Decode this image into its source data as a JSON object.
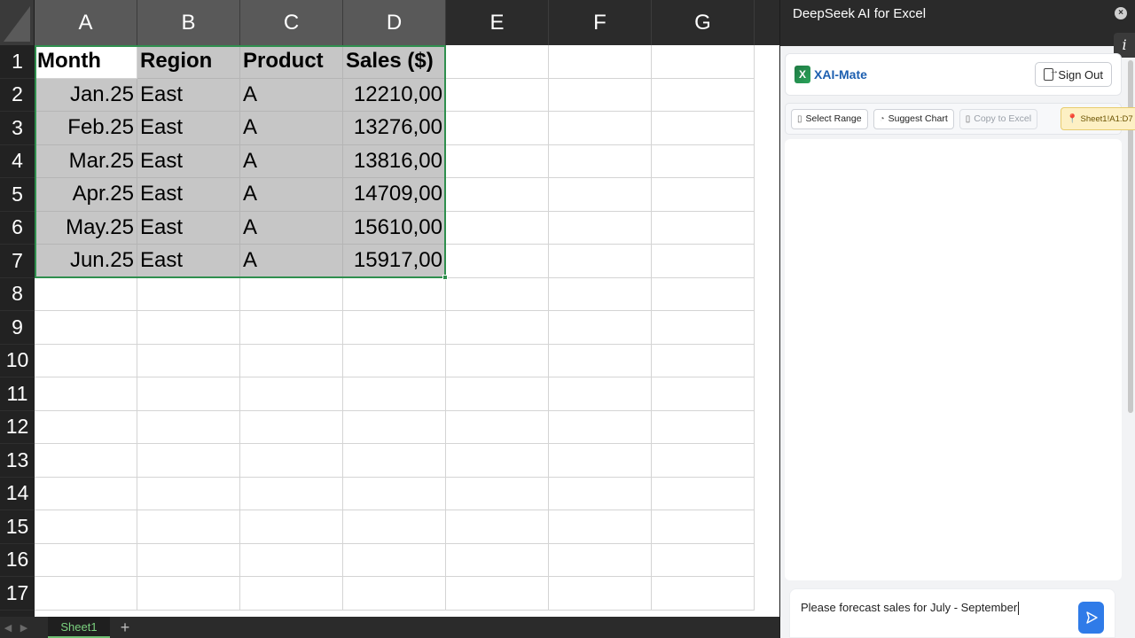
{
  "sheet": {
    "columns": [
      "A",
      "B",
      "C",
      "D",
      "E",
      "F",
      "G"
    ],
    "rows": [
      "1",
      "2",
      "3",
      "4",
      "5",
      "6",
      "7",
      "8",
      "9",
      "10",
      "11",
      "12",
      "13",
      "14",
      "15",
      "16",
      "17"
    ],
    "table_header": [
      "Month",
      "Region",
      "Product",
      "Sales ($)"
    ],
    "table_rows": [
      [
        "Jan.25",
        "East",
        "A",
        "12210,00"
      ],
      [
        "Feb.25",
        "East",
        "A",
        "13276,00"
      ],
      [
        "Mar.25",
        "East",
        "A",
        "13816,00"
      ],
      [
        "Apr.25",
        "East",
        "A",
        "14709,00"
      ],
      [
        "May.25",
        "East",
        "A",
        "15610,00"
      ],
      [
        "Jun.25",
        "East",
        "A",
        "15917,00"
      ]
    ],
    "tab_name": "Sheet1",
    "add_tab": "+",
    "selection_color": "#2f8f4e"
  },
  "panel": {
    "title": "DeepSeek AI for Excel",
    "close": "×",
    "info": "i",
    "brand": {
      "logo": "X",
      "name": "XAI-Mate"
    },
    "sign_out": "Sign Out",
    "toolbar": {
      "select_range": "Select Range",
      "suggest_chart": "Suggest Chart",
      "copy_to_excel": "Copy to Excel",
      "range": "Sheet1!A1:D7"
    },
    "input_text": "Please forecast sales for July - September",
    "accent_color": "#2f7be8"
  }
}
